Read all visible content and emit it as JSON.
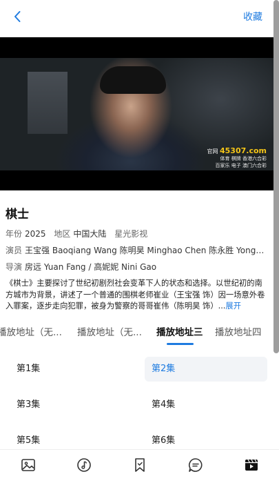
{
  "topbar": {
    "favorite_label": "收藏"
  },
  "player": {
    "watermark_prefix": "官网",
    "watermark_domain": "45307.com",
    "watermark_line2": "体育 棋牌 香港六合彩",
    "watermark_line3": "百家乐 电子 澳门六合彩"
  },
  "info": {
    "title": "棋士",
    "year_label": "年份",
    "year": "2025",
    "region_label": "地区",
    "region": "中国大陆",
    "studio": "星光影视",
    "cast_label": "演员",
    "cast": "王宝强 Baoqiang Wang  陈明昊 Minghao Chen  陈永胜 Yongsheng Chen",
    "director_label": "导演",
    "director": "房远 Yuan Fang / 高妮妮 Nini Gao",
    "description": "《棋士》主要探讨了世纪初剧烈社会变革下人的状态和选择。以世纪初的南方城市为背景，讲述了一个普通的围棋老师崔业（王宝强 饰）因一场意外卷入罪案，逐步走向犯罪，被身为警察的哥哥崔伟（陈明昊 饰）...",
    "expand_label": "展开"
  },
  "tabs": [
    {
      "label": "播放地址（无..."
    },
    {
      "label": "播放地址（无..."
    },
    {
      "label": "播放地址三"
    },
    {
      "label": "播放地址四"
    }
  ],
  "active_tab": 2,
  "episodes": [
    {
      "label": "第1集"
    },
    {
      "label": "第2集"
    },
    {
      "label": "第3集"
    },
    {
      "label": "第4集"
    },
    {
      "label": "第5集"
    },
    {
      "label": "第6集"
    }
  ],
  "active_episode": 1,
  "colors": {
    "accent": "#1e7be0",
    "episode_active_bg": "#f2f4f7"
  },
  "bottom_nav": [
    {
      "icon": "image-icon"
    },
    {
      "icon": "music-icon"
    },
    {
      "icon": "bookmark-icon"
    },
    {
      "icon": "chat-icon"
    },
    {
      "icon": "video-icon"
    }
  ]
}
